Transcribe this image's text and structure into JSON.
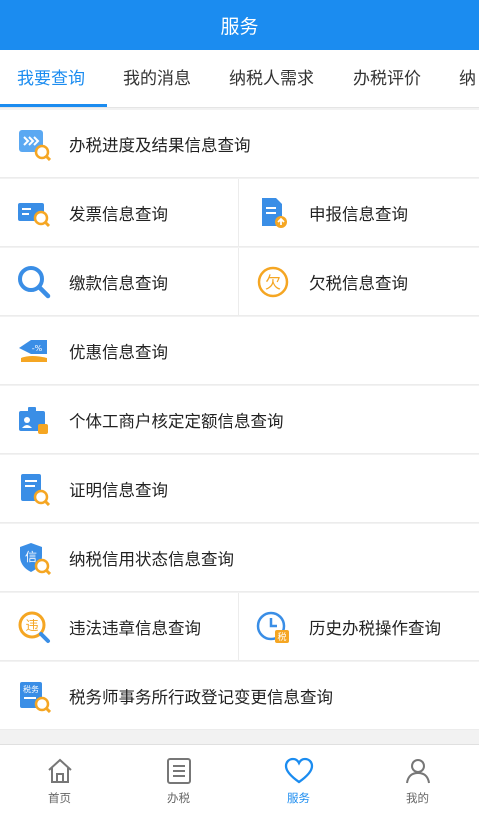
{
  "header": {
    "title": "服务"
  },
  "tabs": [
    {
      "label": "我要查询",
      "active": true
    },
    {
      "label": "我的消息"
    },
    {
      "label": "纳税人需求"
    },
    {
      "label": "办税评价"
    },
    {
      "label": "纳"
    }
  ],
  "items": {
    "progress": {
      "label": "办税进度及结果信息查询",
      "icon": "progress-query-icon"
    },
    "invoice": {
      "label": "发票信息查询",
      "icon": "invoice-query-icon"
    },
    "declaration": {
      "label": "申报信息查询",
      "icon": "declaration-query-icon"
    },
    "payment": {
      "label": "缴款信息查询",
      "icon": "payment-search-icon"
    },
    "arrears": {
      "label": "欠税信息查询",
      "icon": "arrears-icon",
      "glyph": "欠"
    },
    "preferential": {
      "label": "优惠信息查询",
      "icon": "discount-icon",
      "glyph": "-%"
    },
    "quota": {
      "label": "个体工商户核定定额信息查询",
      "icon": "business-quota-icon"
    },
    "certificate": {
      "label": "证明信息查询",
      "icon": "certificate-query-icon"
    },
    "credit": {
      "label": "纳税信用状态信息查询",
      "icon": "credit-status-icon",
      "glyph": "信"
    },
    "violation": {
      "label": "违法违章信息查询",
      "icon": "violation-icon",
      "glyph": "违"
    },
    "history": {
      "label": "历史办税操作查询",
      "icon": "history-clock-icon",
      "glyph": "税"
    },
    "agency": {
      "label": "税务师事务所行政登记变更信息查询",
      "icon": "agency-registration-icon",
      "glyph": "税务"
    }
  },
  "bottom_nav": [
    {
      "label": "首页",
      "icon": "home-icon"
    },
    {
      "label": "办税",
      "icon": "list-icon"
    },
    {
      "label": "服务",
      "icon": "heart-icon",
      "active": true
    },
    {
      "label": "我的",
      "icon": "user-icon"
    }
  ],
  "colors": {
    "primary": "#1b8cf0",
    "accent_orange": "#f5a623",
    "text": "#222222"
  }
}
